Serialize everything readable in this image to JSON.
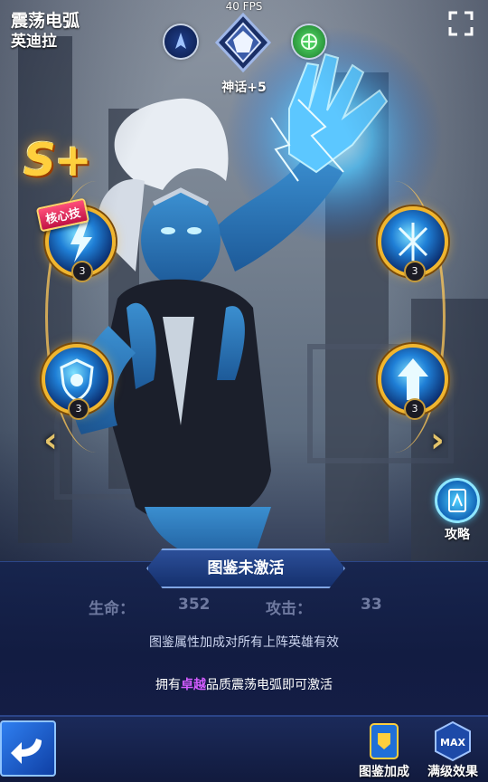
{
  "header": {
    "hero_title": "震荡电弧",
    "hero_name": "英迪拉",
    "fps": "40 FPS",
    "rank_label": "神话+5"
  },
  "grade": "S+",
  "core_tag": "核心技",
  "skills": [
    {
      "icon": "lightning-skill-icon",
      "level": "3"
    },
    {
      "icon": "shield-skill-icon",
      "level": "3"
    },
    {
      "icon": "storm-skill-icon",
      "level": "3"
    },
    {
      "icon": "arrow-up-skill-icon",
      "level": "3"
    }
  ],
  "strategy_label": "攻略",
  "panel": {
    "banner": "图鉴未激活",
    "hp_label": "生命：",
    "hp_value": "352",
    "atk_label": "攻击：",
    "atk_value": "33",
    "description": "图鉴属性加成对所有上阵英雄有效",
    "activate_prefix": "拥有",
    "activate_quality": "卓越",
    "activate_suffix": "品质震荡电弧即可激活"
  },
  "bottom": {
    "bonus_label": "图鉴加成",
    "max_label": "满级效果",
    "max_badge": "MAX"
  },
  "colors": {
    "gold": "#f0b52e",
    "quality_purple": "#d35cff",
    "panel_bg": "#141d45",
    "accent_blue": "#2f7ff0"
  }
}
